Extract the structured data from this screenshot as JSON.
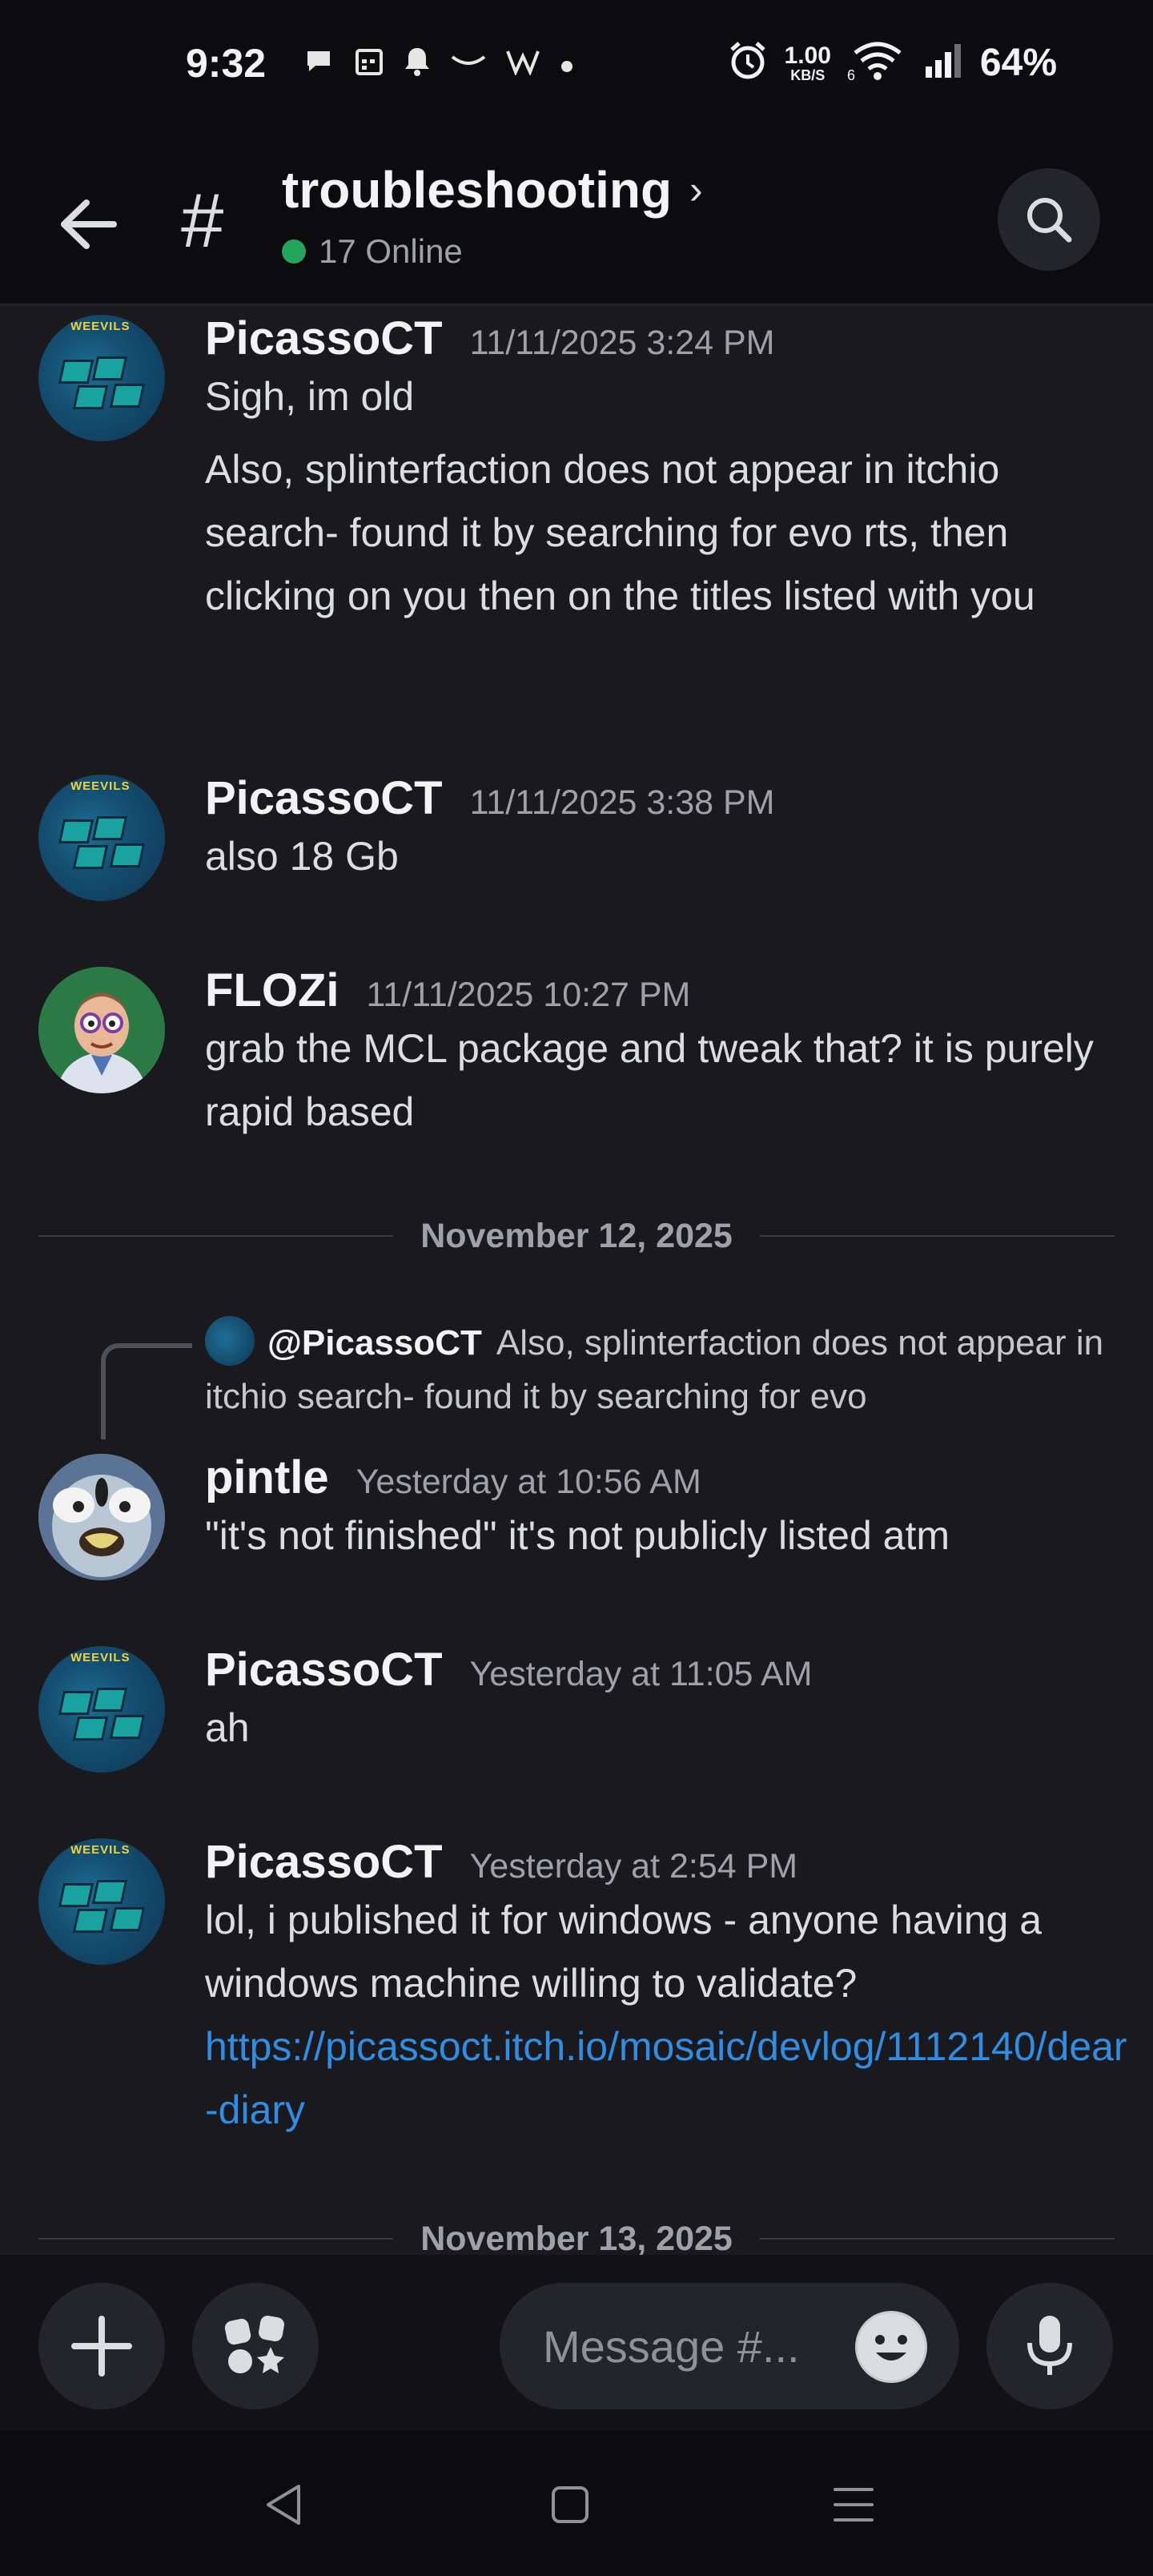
{
  "status_bar": {
    "time": "9:32",
    "left_icons": [
      "chat-bubble-icon",
      "calendar-icon",
      "bell-icon",
      "amazon-icon",
      "w-icon",
      "dot-icon"
    ],
    "speed_value": "1.00",
    "speed_unit": "KB/S",
    "battery": "64%"
  },
  "header": {
    "channel_hash": "#",
    "channel_name": "troubleshooting",
    "online_text": "17 Online",
    "online_color": "#23a55a"
  },
  "messages": [
    {
      "author": "PicassoCT",
      "timestamp": "11/11/2025 3:24 PM",
      "lines": [
        "Sigh, im old",
        "Also, splinterfaction does not appear in itchio search- found it by searching for evo rts, then clicking on you then on the titles listed with you"
      ]
    },
    {
      "author": "PicassoCT",
      "timestamp": "11/11/2025 3:38 PM",
      "lines": [
        "also 18 Gb"
      ]
    },
    {
      "author": "FLOZi",
      "timestamp": "11/11/2025 10:27 PM",
      "lines": [
        "grab the MCL package and tweak that? it is purely rapid based"
      ]
    },
    {
      "reply_to": "@PicassoCT",
      "reply_text": "Also, splinterfaction does not appear in itchio search- found it by searching for evo",
      "author": "pintle",
      "timestamp": "Yesterday at 10:56 AM",
      "lines": [
        "\"it's not finished\" it's not publicly listed atm"
      ]
    },
    {
      "author": "PicassoCT",
      "timestamp": "Yesterday at 11:05 AM",
      "lines": [
        "ah"
      ]
    },
    {
      "author": "PicassoCT",
      "timestamp": "Yesterday at 2:54 PM",
      "lines": [
        "lol, i published it for windows - anyone having a windows machine willing to validate?"
      ],
      "link": "https://picassoct.itch.io/mosaic/devlog/1112140/dear-diary"
    }
  ],
  "dividers": [
    "November 12, 2025",
    "November 13, 2025"
  ],
  "avatar_badge": "WEEVILS",
  "composer": {
    "placeholder": "Message #..."
  },
  "colors": {
    "background": "#1a1a1e",
    "link": "#2f8de4",
    "accent_online": "#23a55a"
  }
}
